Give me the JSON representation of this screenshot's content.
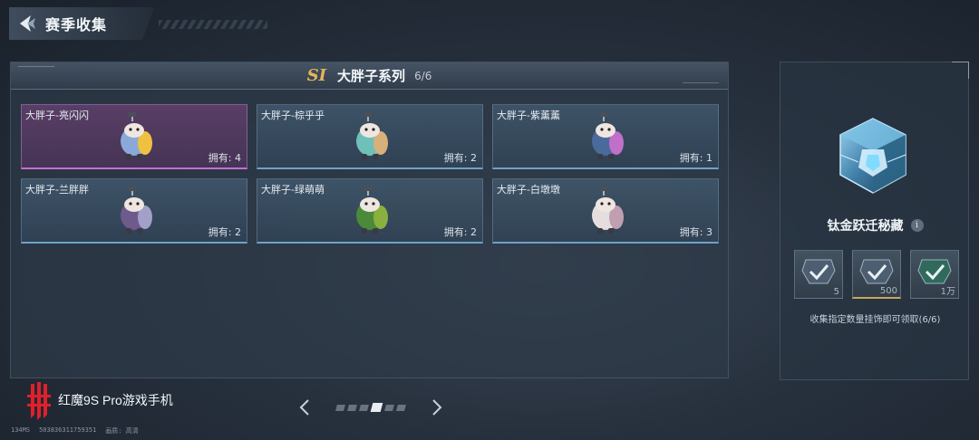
{
  "header": {
    "title": "赛季收集"
  },
  "panel": {
    "season_badge": "SI",
    "series_name": "大胖子系列",
    "series_count": "6/6"
  },
  "cards": [
    {
      "name": "大胖子-亮闪闪",
      "count": "拥有: 4",
      "selected": true,
      "body": "#8aa8d8",
      "accent": "#f0c040"
    },
    {
      "name": "大胖子-棕乎乎",
      "count": "拥有: 2",
      "selected": false,
      "body": "#6fc0b8",
      "accent": "#d8b07a"
    },
    {
      "name": "大胖子-紫薰薰",
      "count": "拥有: 1",
      "selected": false,
      "body": "#4a6a9c",
      "accent": "#c070c8"
    },
    {
      "name": "大胖子-兰胖胖",
      "count": "拥有: 2",
      "selected": false,
      "body": "#6e5a8c",
      "accent": "#a0a0c8"
    },
    {
      "name": "大胖子-绿萌萌",
      "count": "拥有: 2",
      "selected": false,
      "body": "#4a8a3a",
      "accent": "#8ab040"
    },
    {
      "name": "大胖子-白墩墩",
      "count": "拥有: 3",
      "selected": false,
      "body": "#e6dede",
      "accent": "#c0a0b0"
    }
  ],
  "pager": {
    "pages": 6,
    "active_page": 4
  },
  "reward": {
    "title": "钛金跃迁秘藏",
    "info": "i",
    "tiers": [
      {
        "amount": "5",
        "icon": "check-badge-icon"
      },
      {
        "amount": "500",
        "icon": "check-badge-icon"
      },
      {
        "amount": "1万",
        "icon": "check-badge-icon"
      }
    ],
    "description": "收集指定数量挂饰即可领取(6/6)"
  },
  "brand": {
    "text": "红魔9S Pro游戏手机"
  },
  "footer": {
    "ping": "134MS",
    "uid": "503836311759351",
    "quality": "画质: 高清"
  }
}
